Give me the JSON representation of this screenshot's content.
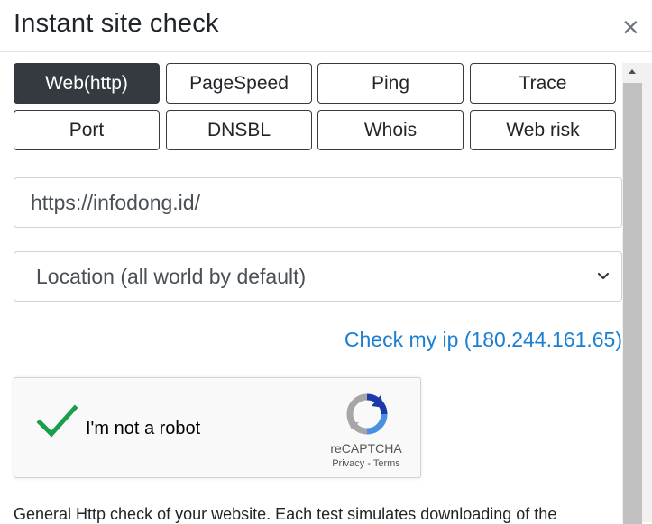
{
  "header": {
    "title": "Instant site check",
    "close_symbol": "×"
  },
  "tabs": [
    {
      "label": "Web(http)",
      "active": true
    },
    {
      "label": "PageSpeed",
      "active": false
    },
    {
      "label": "Ping",
      "active": false
    },
    {
      "label": "Trace",
      "active": false
    },
    {
      "label": "Port",
      "active": false
    },
    {
      "label": "DNSBL",
      "active": false
    },
    {
      "label": "Whois",
      "active": false
    },
    {
      "label": "Web risk",
      "active": false
    }
  ],
  "url_input": {
    "value": "https://infodong.id/"
  },
  "location_select": {
    "selected": "Location (all world by default)"
  },
  "check_ip": {
    "label": "Check my ip (180.244.161.65)"
  },
  "captcha": {
    "label": "I'm not a robot",
    "checked": true,
    "brand": "reCAPTCHA",
    "privacy": "Privacy",
    "separator": " - ",
    "terms": "Terms"
  },
  "description": "General Http check of your website. Each test simulates downloading of the",
  "colors": {
    "active_tab": "#343a40",
    "link": "#1a7fd1",
    "check": "#1a9e4b"
  },
  "icons": [
    "close-icon",
    "chevron-down-icon",
    "checkmark-icon",
    "recaptcha-logo-icon"
  ]
}
